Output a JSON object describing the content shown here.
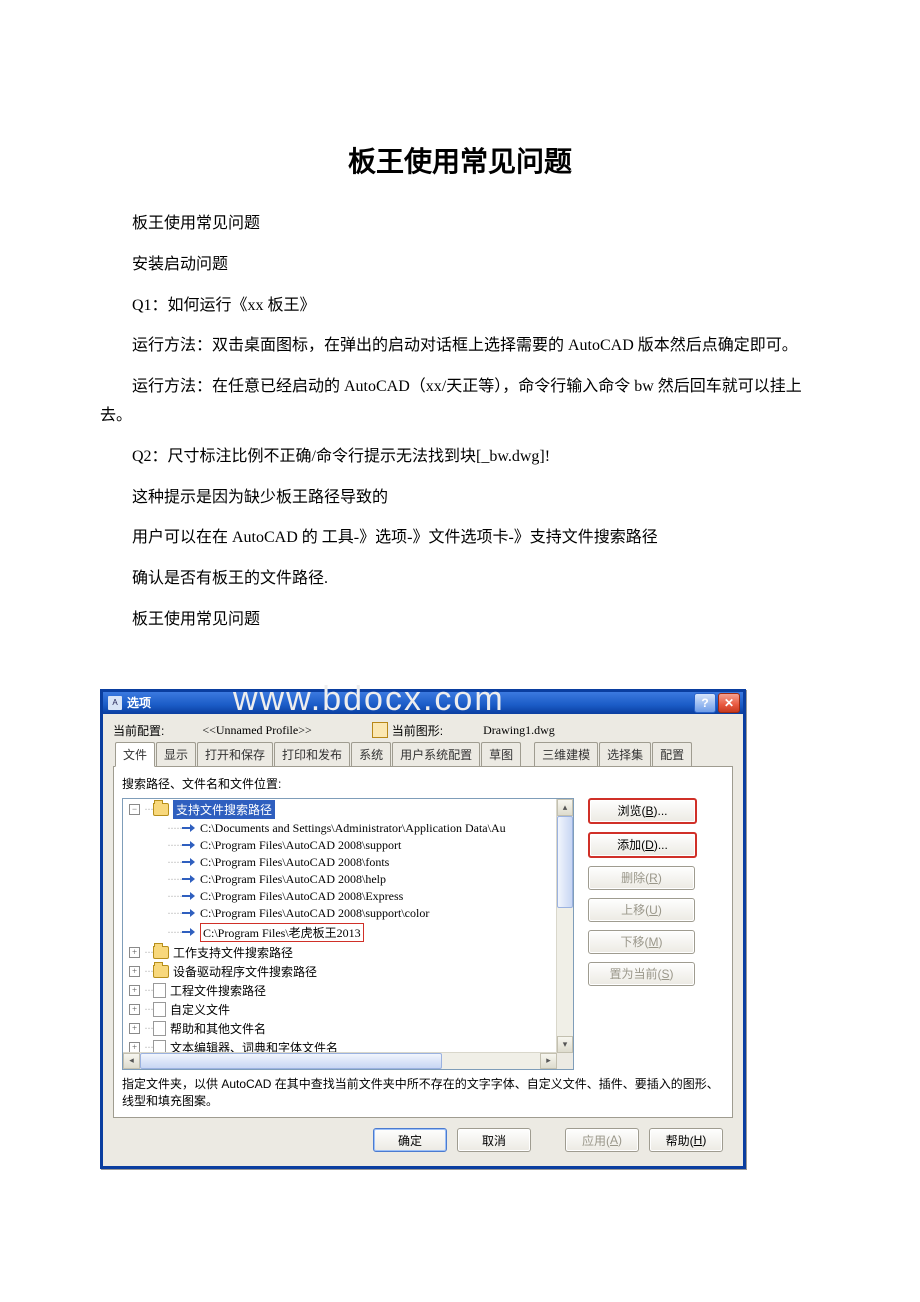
{
  "doc": {
    "title": "板王使用常见问题",
    "p1": "板王使用常见问题",
    "p2": "安装启动问题",
    "p3": "Q1：如何运行《xx 板王》",
    "p4": "运行方法：双击桌面图标，在弹出的启动对话框上选择需要的 AutoCAD 版本然后点确定即可。",
    "p5": "运行方法：在任意已经启动的 AutoCAD（xx/天正等），命令行输入命令 bw 然后回车就可以挂上去。",
    "p6": "Q2：尺寸标注比例不正确/命令行提示无法找到块[_bw.dwg]!",
    "p7": "这种提示是因为缺少板王路径导致的",
    "p8": "用户可以在在 AutoCAD 的 工具-》选项-》文件选项卡-》支持文件搜索路径",
    "p9": " 确认是否有板王的文件路径.",
    "p10": "板王使用常见问题"
  },
  "watermark": "www.bdocx.com",
  "dialog": {
    "title": "选项",
    "cfg_label": "当前配置:",
    "cfg_value": "<<Unnamed Profile>>",
    "dwg_label": "当前图形:",
    "dwg_value": "Drawing1.dwg",
    "tabs": [
      "文件",
      "显示",
      "打开和保存",
      "打印和发布",
      "系统",
      "用户系统配置",
      "草图",
      "三维建模",
      "选择集",
      "配置"
    ],
    "panel_title": "搜索路径、文件名和文件位置:",
    "tree": {
      "root": "支持文件搜索路径",
      "paths": [
        "C:\\Documents and Settings\\Administrator\\Application Data\\Au",
        "C:\\Program Files\\AutoCAD 2008\\support",
        "C:\\Program Files\\AutoCAD 2008\\fonts",
        "C:\\Program Files\\AutoCAD 2008\\help",
        "C:\\Program Files\\AutoCAD 2008\\Express",
        "C:\\Program Files\\AutoCAD 2008\\support\\color",
        "C:\\Program Files\\老虎板王2013"
      ],
      "siblings": [
        "工作支持文件搜索路径",
        "设备驱动程序文件搜索路径",
        "工程文件搜索路径",
        "自定义文件",
        "帮助和其他文件名",
        "文本编辑器、词典和字体文件名"
      ]
    },
    "side_buttons": {
      "browse": "浏览(<u>B</u>)...",
      "add": "添加(<u>D</u>)...",
      "remove": "删除(<u>R</u>)",
      "up": "上移(<u>U</u>)",
      "down": "下移(<u>M</u>)",
      "current": "置为当前(<u>S</u>)"
    },
    "hint": "指定文件夹，以供 AutoCAD 在其中查找当前文件夹中所不存在的文字字体、自定义文件、插件、要插入的图形、线型和填充图案。",
    "footer": {
      "ok": "确定",
      "cancel": "取消",
      "apply": "应用(<u>A</u>)",
      "help": "帮助(<u>H</u>)"
    }
  }
}
